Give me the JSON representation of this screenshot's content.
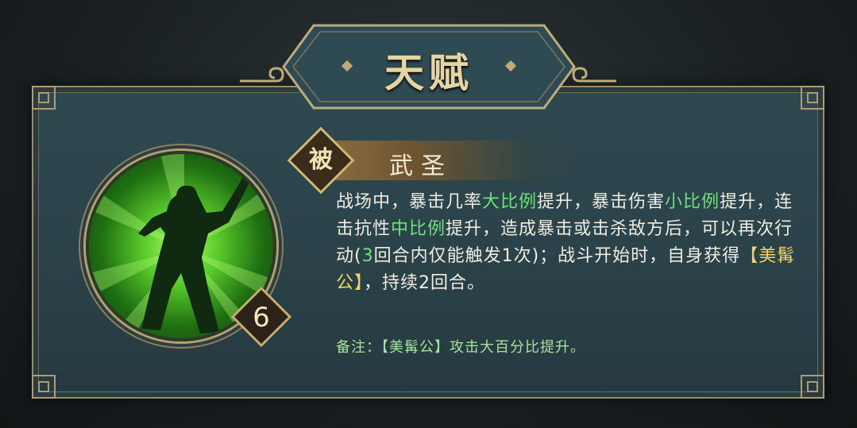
{
  "header": {
    "title": "天赋"
  },
  "skill": {
    "type_badge": "被",
    "name": "武圣",
    "level": "6",
    "description": [
      {
        "text": "战场中，暴击几率",
        "style": "normal"
      },
      {
        "text": "大比例",
        "style": "green"
      },
      {
        "text": "提升，暴击伤害",
        "style": "normal"
      },
      {
        "text": "小比例",
        "style": "green"
      },
      {
        "text": "提升，连击抗性",
        "style": "normal"
      },
      {
        "text": "中比例",
        "style": "green"
      },
      {
        "text": "提升，造成暴击或击杀敌方后，可以再次行动(",
        "style": "normal"
      },
      {
        "text": "3",
        "style": "green"
      },
      {
        "text": "回合内仅能触发1次)；战斗开始时，自身获得",
        "style": "normal"
      },
      {
        "text": "【美髯公】",
        "style": "gold"
      },
      {
        "text": "，持续2回合。",
        "style": "normal"
      }
    ],
    "note": "备注：【美髯公】攻击大百分比提升。"
  },
  "colors": {
    "highlight_green": "#6fe07a",
    "highlight_gold": "#f6d264",
    "frame_gold": "#b09c70"
  },
  "icons": {
    "portrait": "warrior-silhouette-icon",
    "corners": "fret-corner-icon"
  }
}
